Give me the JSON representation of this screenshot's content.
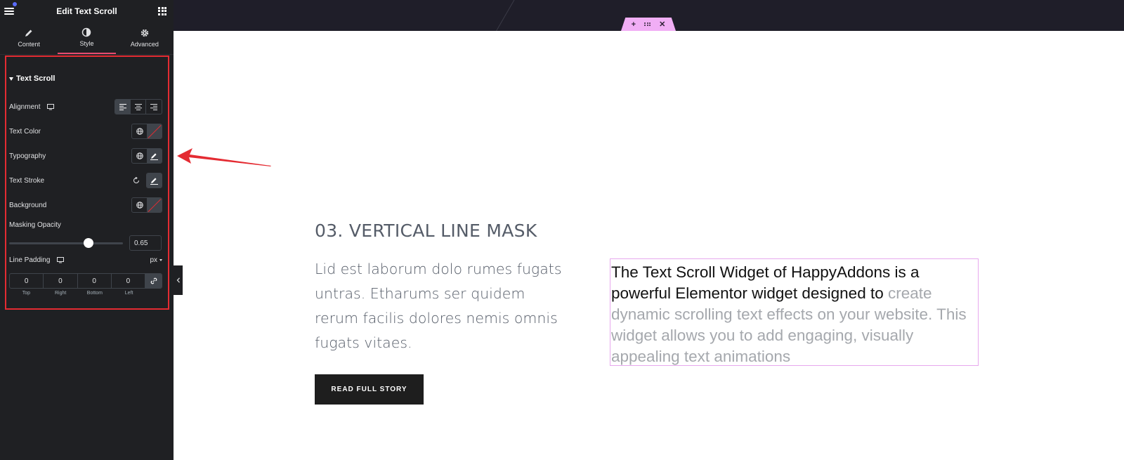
{
  "panel": {
    "title": "Edit Text Scroll",
    "tabs": [
      {
        "label": "Content",
        "icon": "pencil-icon"
      },
      {
        "label": "Style",
        "icon": "half-circle-icon"
      },
      {
        "label": "Advanced",
        "icon": "gear-icon"
      }
    ],
    "active_tab": "Style",
    "section_title": "Text Scroll",
    "controls": {
      "alignment": "Alignment",
      "text_color": "Text Color",
      "typography": "Typography",
      "text_stroke": "Text Stroke",
      "background": "Background",
      "masking_opacity": "Masking Opacity",
      "masking_opacity_value": "0.65",
      "line_padding": "Line Padding",
      "line_padding_unit": "px"
    },
    "padding": {
      "values": [
        "0",
        "0",
        "0",
        "0"
      ],
      "labels": [
        "Top",
        "Right",
        "Bottom",
        "Left"
      ]
    }
  },
  "canvas": {
    "handle_icons": [
      "plus-icon",
      "drag-icon",
      "close-icon"
    ],
    "heading": "03. VERTICAL LINE MASK",
    "paragraph": "Lid est laborum dolo rumes fugats untras. Etharums ser quidem rerum facilis dolores nemis omnis fugats vitaes.",
    "button": "READ FULL STORY",
    "scroll_text_highlight": "The Text Scroll Widget of HappyAddons is a powerful Elementor widget designed to",
    "scroll_text_dim": "create dynamic scrolling text effects on your website. This widget allows you to add engaging, visually appealing text animations"
  },
  "colors": {
    "panel_bg": "#1f2023",
    "accent_red": "#e42b32",
    "handle_pink": "#f1aef5"
  }
}
